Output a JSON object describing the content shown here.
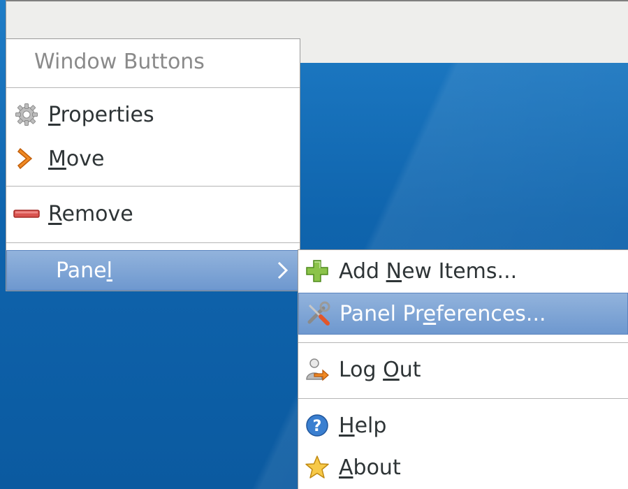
{
  "context_menu": {
    "title": "Window Buttons",
    "items": [
      {
        "label": "Properties",
        "mnemonic": "P",
        "icon": "gear-icon"
      },
      {
        "label": "Move",
        "mnemonic": "M",
        "icon": "move-arrow-icon"
      },
      {
        "label": "Remove",
        "mnemonic": "R",
        "icon": "remove-icon"
      },
      {
        "label": "Panel",
        "mnemonic": "l",
        "icon": "none",
        "submenu": true
      }
    ]
  },
  "panel_submenu": {
    "items": [
      {
        "label": "Add New Items...",
        "mnemonic": "N",
        "icon": "add-plus-icon"
      },
      {
        "label": "Panel Preferences...",
        "mnemonic": "e",
        "icon": "preferences-tools-icon"
      },
      {
        "label": "Log Out",
        "mnemonic": "O",
        "icon": "log-out-icon"
      },
      {
        "label": "Help",
        "mnemonic": "H",
        "icon": "help-icon"
      },
      {
        "label": "About",
        "mnemonic": "A",
        "icon": "star-icon"
      }
    ]
  },
  "colors": {
    "highlight": "#7aa1d6",
    "desktop": "#0d5ea8",
    "menu_bg": "#ffffff"
  }
}
